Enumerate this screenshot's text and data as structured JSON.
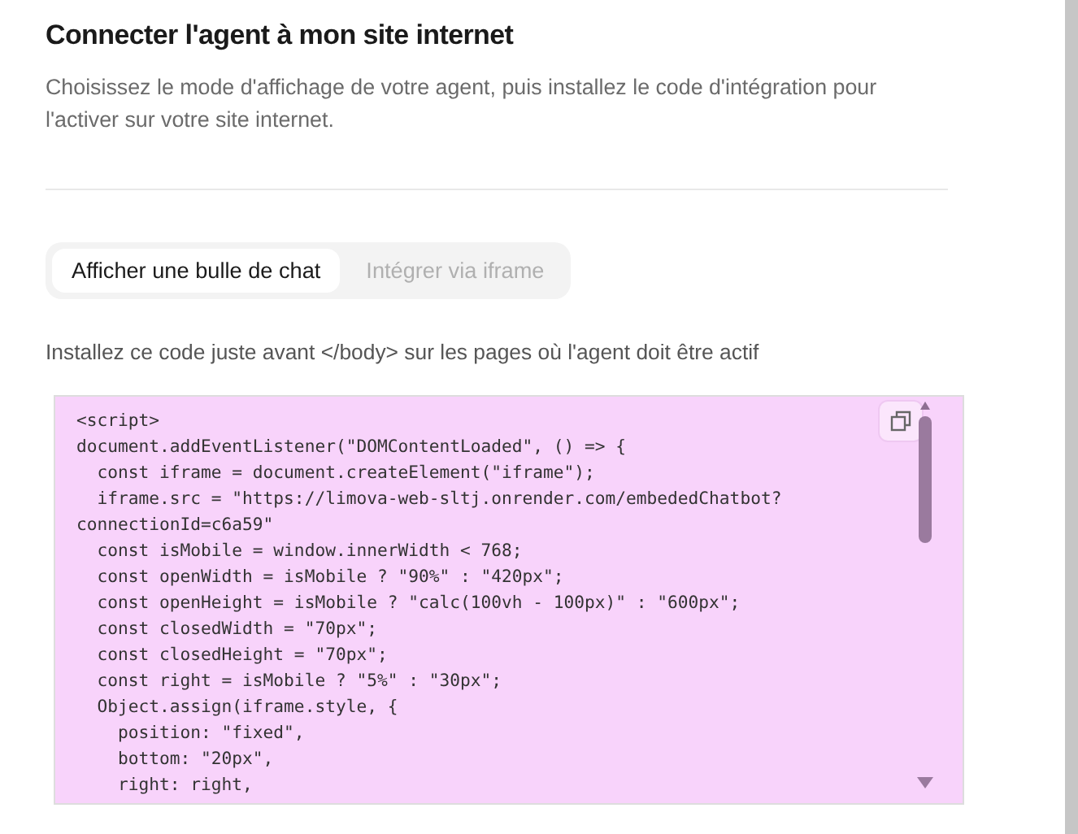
{
  "title": "Connecter l'agent à mon site internet",
  "description": "Choisissez le mode d'affichage de votre agent, puis installez le code d'intégration pour l'activer sur votre site internet.",
  "tabs": [
    {
      "label": "Afficher une bulle de chat",
      "selected": true
    },
    {
      "label": "Intégrer via iframe",
      "selected": false
    }
  ],
  "instruction": "Installez ce code juste avant </body> sur les pages où l'agent doit être actif",
  "code_lines": [
    "<script>",
    "document.addEventListener(\"DOMContentLoaded\", () => {",
    "  const iframe = document.createElement(\"iframe\");",
    "  iframe.src = \"https://limova-web-sltj.onrender.com/embededChatbot?",
    "connectionId=c6a59\"",
    "  const isMobile = window.innerWidth < 768;",
    "  const openWidth = isMobile ? \"90%\" : \"420px\";",
    "  const openHeight = isMobile ? \"calc(100vh - 100px)\" : \"600px\";",
    "  const closedWidth = \"70px\";",
    "  const closedHeight = \"70px\";",
    "  const right = isMobile ? \"5%\" : \"30px\";",
    "  Object.assign(iframe.style, {",
    "    position: \"fixed\",",
    "    bottom: \"20px\",",
    "    right: right,"
  ]
}
